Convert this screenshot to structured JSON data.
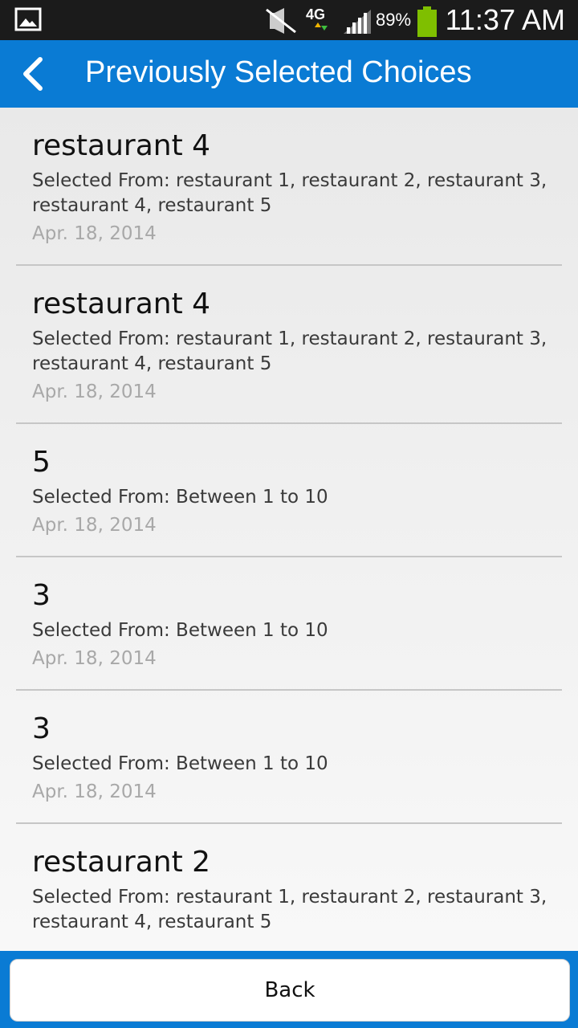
{
  "status_bar": {
    "battery_percent": "89%",
    "time": "11:37 AM",
    "network": "4G",
    "icons": [
      "gallery-icon",
      "mute-icon",
      "network-4g-icon",
      "signal-icon",
      "battery-icon"
    ]
  },
  "header": {
    "title": "Previously Selected Choices",
    "back_icon": "chevron-left-icon",
    "background": "#0a7bd4"
  },
  "items": [
    {
      "title": "restaurant 4",
      "source_prefix": "Selected From: restaurant 1, restaurant 2, restaurant 3,",
      "source_rest": "restaurant 4, restaurant 5",
      "date": "Apr. 18, 2014"
    },
    {
      "title": "restaurant 4",
      "source_prefix": "Selected From: restaurant 1, restaurant 2, restaurant 3,",
      "source_rest": "restaurant 4, restaurant 5",
      "date": "Apr. 18, 2014"
    },
    {
      "title": "5",
      "source_prefix": "Selected From: Between 1 to 10",
      "source_rest": "",
      "date": "Apr. 18, 2014"
    },
    {
      "title": "3",
      "source_prefix": "Selected From: Between 1 to 10",
      "source_rest": "",
      "date": "Apr. 18, 2014"
    },
    {
      "title": "3",
      "source_prefix": "Selected From: Between 1 to 10",
      "source_rest": "",
      "date": "Apr. 18, 2014"
    },
    {
      "title": "restaurant 2",
      "source_prefix": "Selected From: restaurant 1, restaurant 2, restaurant 3,",
      "source_rest": "restaurant 4, restaurant 5",
      "date": ""
    }
  ],
  "footer": {
    "back_label": "Back"
  }
}
